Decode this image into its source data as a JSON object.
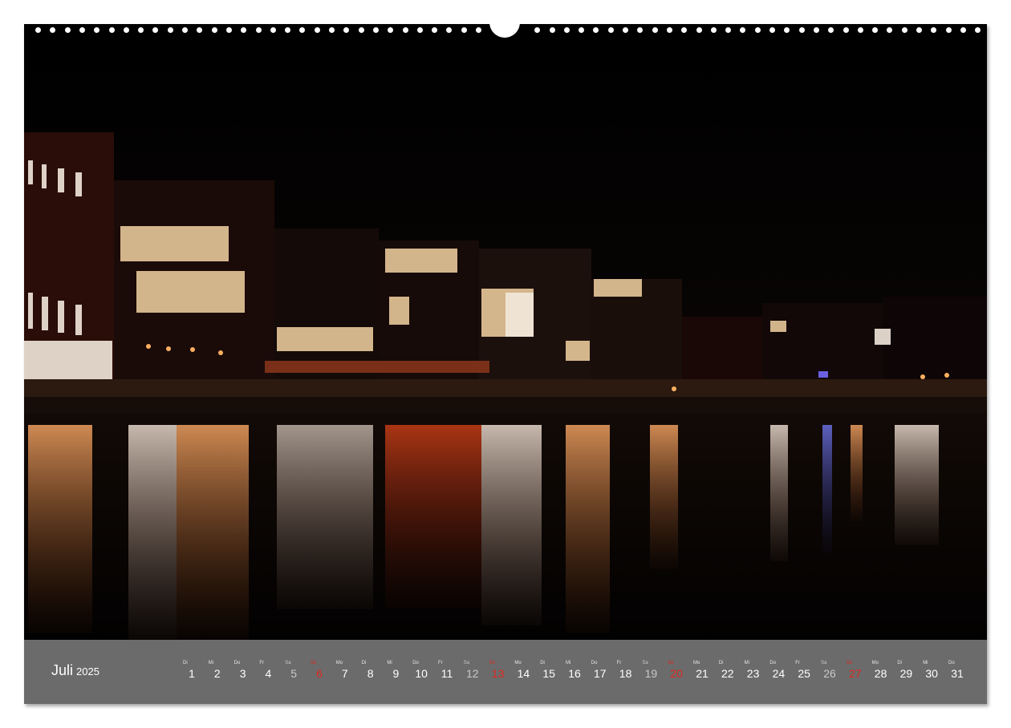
{
  "calendar": {
    "month": "Juli",
    "year": "2025",
    "days": [
      {
        "wd": "Di",
        "n": "1",
        "type": "weekday"
      },
      {
        "wd": "Mi",
        "n": "2",
        "type": "weekday"
      },
      {
        "wd": "Do",
        "n": "3",
        "type": "weekday"
      },
      {
        "wd": "Fr",
        "n": "4",
        "type": "weekday"
      },
      {
        "wd": "Sa",
        "n": "5",
        "type": "sat"
      },
      {
        "wd": "So",
        "n": "6",
        "type": "sun"
      },
      {
        "wd": "Mo",
        "n": "7",
        "type": "weekday"
      },
      {
        "wd": "Di",
        "n": "8",
        "type": "weekday"
      },
      {
        "wd": "Mi",
        "n": "9",
        "type": "weekday"
      },
      {
        "wd": "Do",
        "n": "10",
        "type": "weekday"
      },
      {
        "wd": "Fr",
        "n": "11",
        "type": "weekday"
      },
      {
        "wd": "Sa",
        "n": "12",
        "type": "sat"
      },
      {
        "wd": "So",
        "n": "13",
        "type": "sun"
      },
      {
        "wd": "Mo",
        "n": "14",
        "type": "weekday"
      },
      {
        "wd": "Di",
        "n": "15",
        "type": "weekday"
      },
      {
        "wd": "Mi",
        "n": "16",
        "type": "weekday"
      },
      {
        "wd": "Do",
        "n": "17",
        "type": "weekday"
      },
      {
        "wd": "Fr",
        "n": "18",
        "type": "weekday"
      },
      {
        "wd": "Sa",
        "n": "19",
        "type": "sat"
      },
      {
        "wd": "So",
        "n": "20",
        "type": "sun"
      },
      {
        "wd": "Mo",
        "n": "21",
        "type": "weekday"
      },
      {
        "wd": "Di",
        "n": "22",
        "type": "weekday"
      },
      {
        "wd": "Mi",
        "n": "23",
        "type": "weekday"
      },
      {
        "wd": "Do",
        "n": "24",
        "type": "weekday"
      },
      {
        "wd": "Fr",
        "n": "25",
        "type": "weekday"
      },
      {
        "wd": "Sa",
        "n": "26",
        "type": "sat"
      },
      {
        "wd": "So",
        "n": "27",
        "type": "sun"
      },
      {
        "wd": "Mo",
        "n": "28",
        "type": "weekday"
      },
      {
        "wd": "Di",
        "n": "29",
        "type": "weekday"
      },
      {
        "wd": "Mi",
        "n": "30",
        "type": "weekday"
      },
      {
        "wd": "Do",
        "n": "31",
        "type": "weekday"
      }
    ]
  },
  "colors": {
    "bar": "#6b6b6b",
    "sunday": "#e0271e",
    "photo_bg": "#000000"
  },
  "photo": {
    "subject_icon": "night-harbour-photo-icon"
  }
}
